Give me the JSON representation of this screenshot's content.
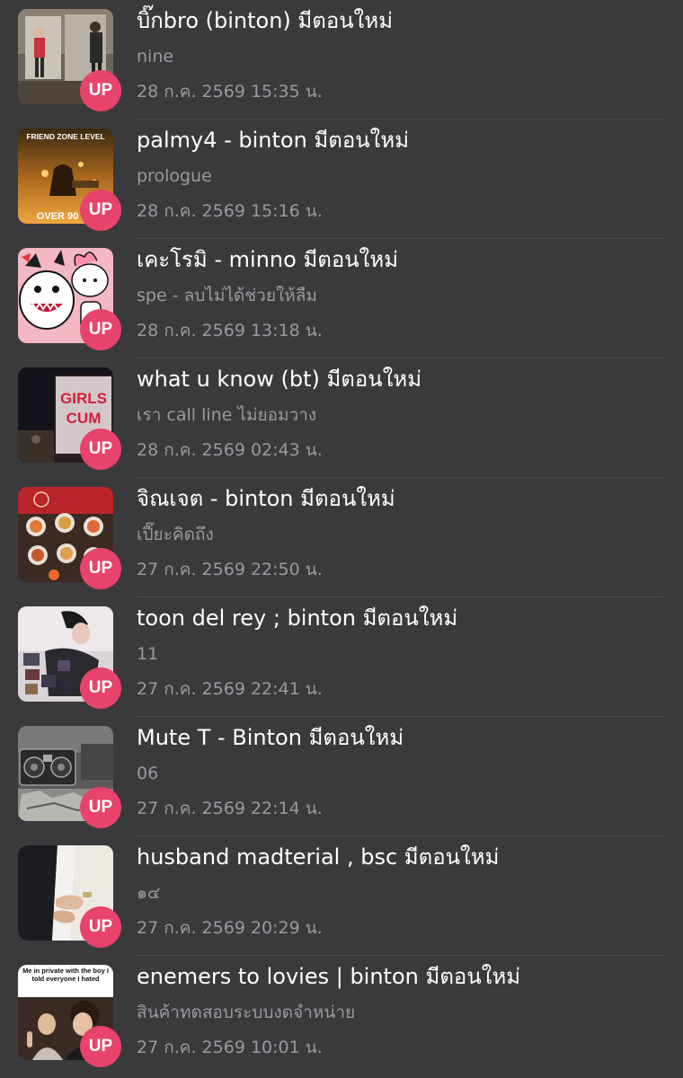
{
  "badge_label": "UP",
  "colors": {
    "background": "#3a3a3c",
    "badge": "#e8436a",
    "title": "#ffffff",
    "secondary": "#9a9a9e"
  },
  "items": [
    {
      "title": "บิ๊กbro (binton) มีตอนใหม่",
      "subtitle": "nine",
      "timestamp": "28 ก.ค. 2569 15:35 น."
    },
    {
      "title": "palmy4 - binton มีตอนใหม่",
      "subtitle": "prologue",
      "timestamp": "28 ก.ค. 2569 15:16 น.",
      "thumb_text_top": "FRIEND ZONE LEVEL",
      "thumb_text_bottom": "OVER 90"
    },
    {
      "title": "เคะโรมิ - minno มีตอนใหม่",
      "subtitle": "spe - ลบไม่ได้ช่วยให้ลืม",
      "timestamp": "28 ก.ค. 2569 13:18 น."
    },
    {
      "title": "what u know (bt) มีตอนใหม่",
      "subtitle": "เรา call line ไม่ยอมวาง",
      "timestamp": "28 ก.ค. 2569 02:43 น.",
      "thumb_text_top": "GIRLS",
      "thumb_text_bottom": "CUM"
    },
    {
      "title": "จิณเจต - binton มีตอนใหม่",
      "subtitle": "เปี๊ยะคิดถึง",
      "timestamp": "27 ก.ค. 2569 22:50 น."
    },
    {
      "title": "toon del rey ; binton มีตอนใหม่",
      "subtitle": "11",
      "timestamp": "27 ก.ค. 2569 22:41 น."
    },
    {
      "title": "Mute T - Binton  มีตอนใหม่",
      "subtitle": "06",
      "timestamp": "27 ก.ค. 2569 22:14 น."
    },
    {
      "title": "husband madterial , bsc มีตอนใหม่",
      "subtitle": "๑๔",
      "timestamp": "27 ก.ค. 2569 20:29 น."
    },
    {
      "title": "enemers to lovies | binton มีตอนใหม่",
      "subtitle": "สินค้าทดสอบระบบงดจำหน่าย",
      "timestamp": "27 ก.ค. 2569 10:01 น.",
      "thumb_text_top": "Me in private with the boy I told everyone I hated"
    }
  ]
}
